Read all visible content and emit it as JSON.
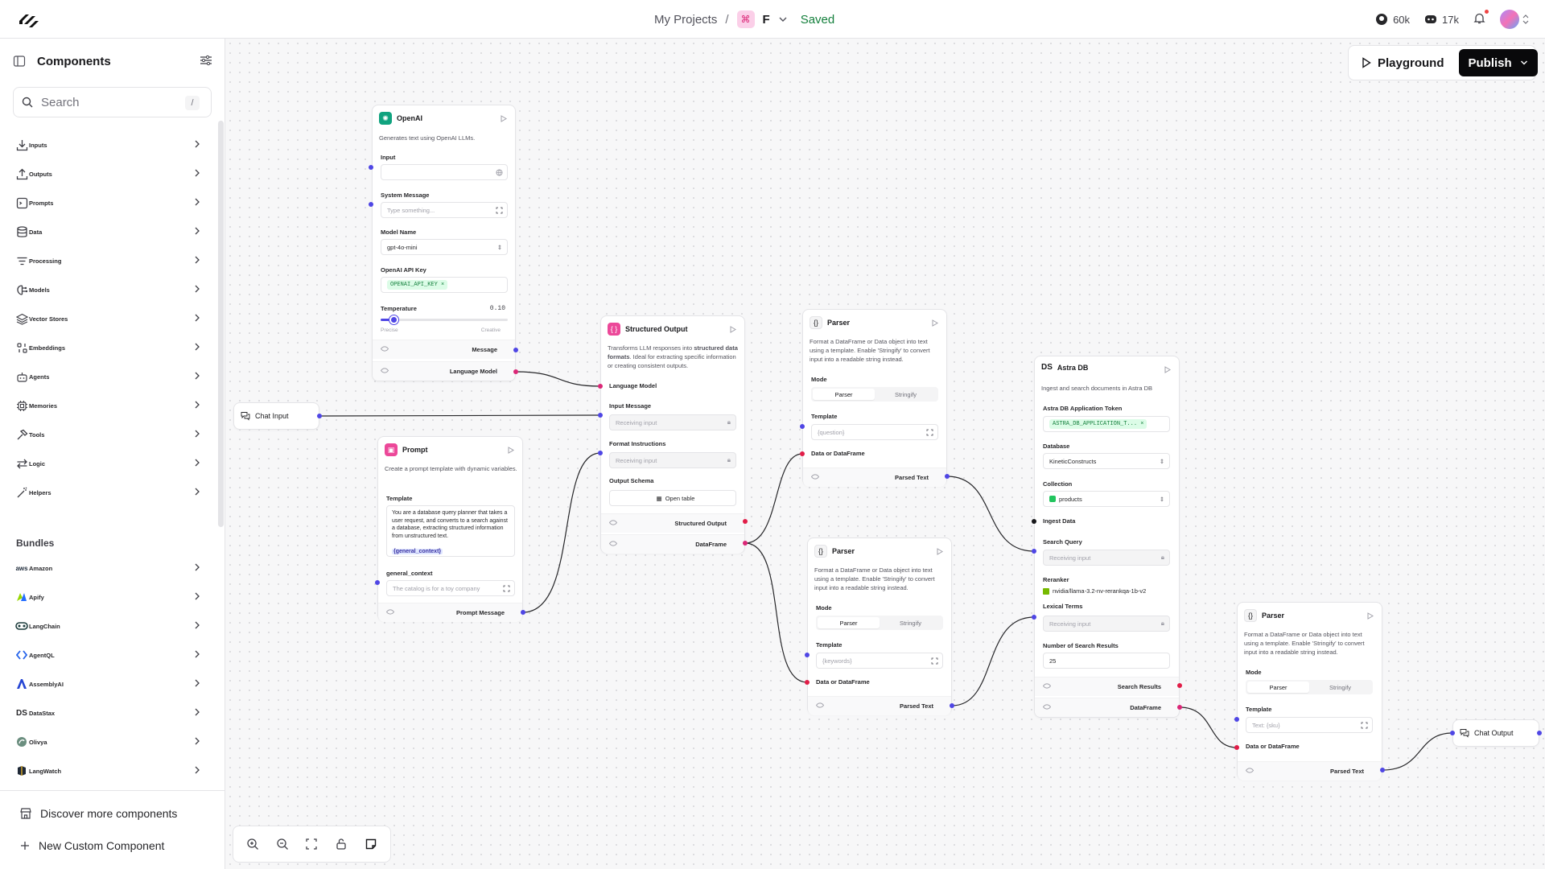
{
  "header": {
    "breadcrumb_root": "My Projects",
    "breadcrumb_sep": "/",
    "project_name": "F",
    "save_status": "Saved",
    "github_stars": "60k",
    "discord_members": "17k"
  },
  "sidebar": {
    "title": "Components",
    "search_placeholder": "Search",
    "search_shortcut": "/",
    "categories": [
      "Inputs",
      "Outputs",
      "Prompts",
      "Data",
      "Processing",
      "Models",
      "Vector Stores",
      "Embeddings",
      "Agents",
      "Memories",
      "Tools",
      "Logic",
      "Helpers"
    ],
    "bundles_title": "Bundles",
    "bundles": [
      "Amazon",
      "Apify",
      "LangChain",
      "AgentQL",
      "AssemblyAI",
      "DataStax",
      "Olivya",
      "LangWatch"
    ],
    "discover": "Discover more components",
    "new_custom": "New Custom Component"
  },
  "toolbar": {
    "playground": "Playground",
    "publish": "Publish"
  },
  "nodes": {
    "openai": {
      "title": "OpenAI",
      "desc": "Generates text using OpenAI LLMs.",
      "input_label": "Input",
      "system_label": "System Message",
      "system_ph": "Type something...",
      "model_label": "Model Name",
      "model_value": "gpt-4o-mini",
      "key_label": "OpenAI API Key",
      "key_value": "OPENAI_API_KEY",
      "temp_label": "Temperature",
      "temp_value": "0.10",
      "temp_min": "Precise",
      "temp_max": "Creative",
      "temperature_level": 0.1,
      "out1": "Message",
      "out2": "Language Model"
    },
    "chat_input": {
      "title": "Chat Input"
    },
    "prompt": {
      "title": "Prompt",
      "desc": "Create a prompt template with dynamic variables.",
      "template_label": "Template",
      "template_text": "You are a database query planner that takes a user request, and converts to a search against a database, extracting structured information from unstructured text.",
      "template_var": "{general_context}",
      "var_label": "general_context",
      "var_value": "The catalog is for a toy company",
      "out": "Prompt Message"
    },
    "structured": {
      "title": "Structured Output",
      "desc_a": "Transforms LLM responses into ",
      "desc_b": "structured data formats",
      "desc_c": ". Ideal for extracting specific information or creating consistent outputs.",
      "lm_label": "Language Model",
      "im_label": "Input Message",
      "im_ph": "Receiving input",
      "fi_label": "Format Instructions",
      "fi_ph": "Receiving input",
      "schema_label": "Output Schema",
      "schema_btn": "Open table",
      "out1": "Structured Output",
      "out2": "DataFrame"
    },
    "parser1": {
      "title": "Parser",
      "desc": "Format a DataFrame or Data object into text using a template. Enable 'Stringify' to convert input into a readable string instead.",
      "mode_label": "Mode",
      "mode_a": "Parser",
      "mode_b": "Stringify",
      "template_label": "Template",
      "template_value": "{question}",
      "data_label": "Data or DataFrame",
      "out": "Parsed Text"
    },
    "parser2": {
      "title": "Parser",
      "desc": "Format a DataFrame or Data object into text using a template. Enable 'Stringify' to convert input into a readable string instead.",
      "mode_label": "Mode",
      "mode_a": "Parser",
      "mode_b": "Stringify",
      "template_label": "Template",
      "template_value": "{keywords}",
      "data_label": "Data or DataFrame",
      "out": "Parsed Text"
    },
    "astra": {
      "title": "Astra DB",
      "desc": "Ingest and search documents in Astra DB",
      "token_label": "Astra DB Application Token",
      "token_value": "ASTRA_DB_APPLICATION_T...",
      "db_label": "Database",
      "db_value": "KineticConstructs",
      "coll_label": "Collection",
      "coll_value": "products",
      "ingest_label": "Ingest Data",
      "sq_label": "Search Query",
      "sq_ph": "Receiving input",
      "rerank_label": "Reranker",
      "rerank_value": "nvidia/llama-3.2-nv-rerankqa-1b-v2",
      "lex_label": "Lexical Terms",
      "lex_ph": "Receiving input",
      "nsr_label": "Number of Search Results",
      "nsr_value": "25",
      "out1": "Search Results",
      "out2": "DataFrame"
    },
    "parser3": {
      "title": "Parser",
      "desc": "Format a DataFrame or Data object into text using a template. Enable 'Stringify' to convert input into a readable string instead.",
      "mode_label": "Mode",
      "mode_a": "Parser",
      "mode_b": "Stringify",
      "template_label": "Template",
      "template_value": "Text: {sku}",
      "data_label": "Data or DataFrame",
      "out": "Parsed Text"
    },
    "chat_output": {
      "title": "Chat Output"
    }
  }
}
